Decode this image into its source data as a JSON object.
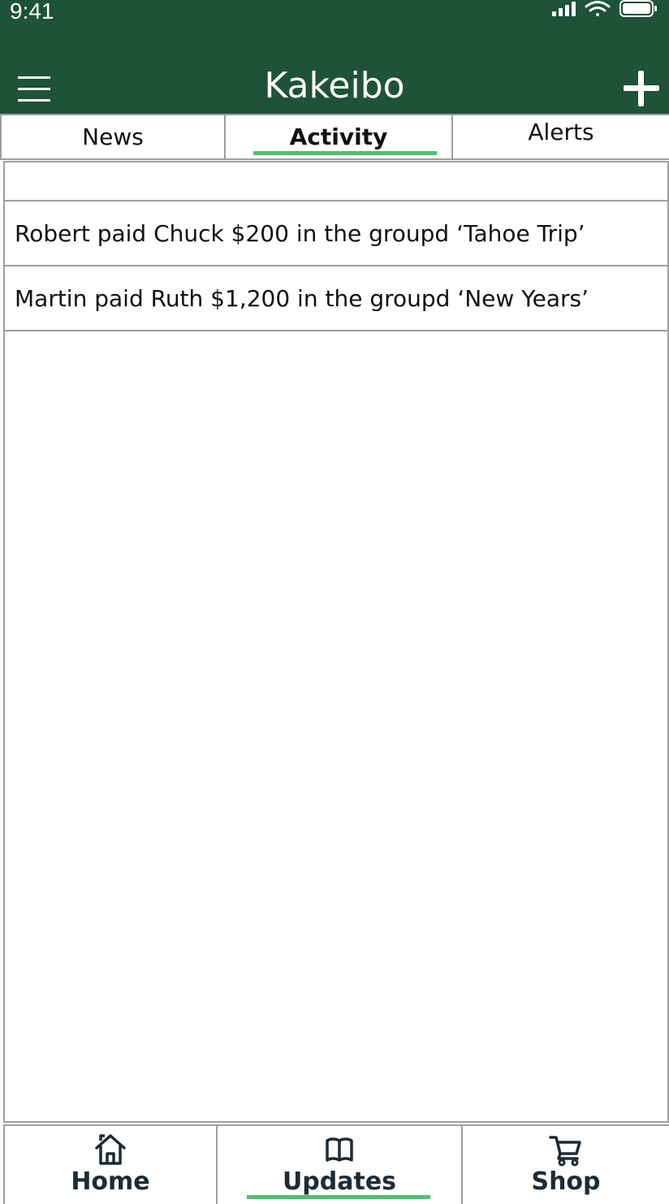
{
  "status_bar": {
    "time": "9:41"
  },
  "header": {
    "title": "Kakeibo",
    "menu_icon": "hamburger-menu-icon",
    "add_icon": "plus-icon",
    "background": "#1e5239"
  },
  "tabs": [
    {
      "label": "News",
      "active": false
    },
    {
      "label": "Activity",
      "active": true
    },
    {
      "label": "Alerts",
      "active": false
    }
  ],
  "activity": [
    {
      "text": "Robert paid Chuck $200 in the groupd ‘Tahoe Trip’"
    },
    {
      "text": "Martin paid Ruth $1,200 in the groupd ‘New Years’"
    }
  ],
  "bottom_nav": [
    {
      "label": "Home",
      "icon": "house-icon",
      "active": false
    },
    {
      "label": "Updates",
      "icon": "book-icon",
      "active": true
    },
    {
      "label": "Shop",
      "icon": "cart-icon",
      "active": false
    }
  ],
  "accent_color": "#4fbf74"
}
